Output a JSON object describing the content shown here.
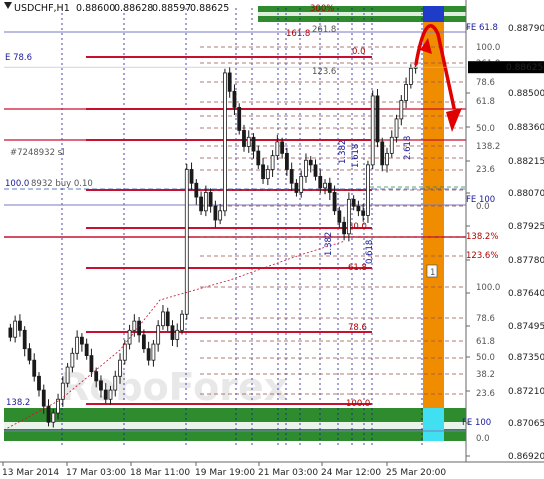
{
  "chart_data": {
    "type": "candlestick",
    "header": {
      "symbol": "USDCHF,H1",
      "ohlc": [
        "0.88600",
        "0.88628",
        "0.88597",
        "0.88625"
      ]
    },
    "last_price": "0.88625",
    "y_ticks": [
      "0.88790",
      "0.88500",
      "0.88360",
      "0.88215",
      "0.88070",
      "0.87925",
      "0.87780",
      "0.87640",
      "0.87495",
      "0.87350",
      "0.87210",
      "0.87065",
      "0.86920"
    ],
    "x_ticks": [
      "13 Mar 2014",
      "17 Mar 03:00",
      "18 Mar 11:00",
      "19 Mar 19:00",
      "21 Mar 03:00",
      "24 Mar 12:00",
      "25 Mar 20:00"
    ],
    "price_range": [
      0.8692,
      0.889
    ],
    "series_close": [
      0.8745,
      0.8752,
      0.8748,
      0.874,
      0.8735,
      0.8728,
      0.8722,
      0.8715,
      0.8708,
      0.8712,
      0.8718,
      0.8725,
      0.8732,
      0.8738,
      0.8745,
      0.8742,
      0.8737,
      0.873,
      0.8726,
      0.8722,
      0.8718,
      0.8722,
      0.8728,
      0.8735,
      0.8742,
      0.8748,
      0.8752,
      0.8746,
      0.874,
      0.8735,
      0.8742,
      0.875,
      0.8756,
      0.875,
      0.8744,
      0.8748,
      0.8755,
      0.8818,
      0.8812,
      0.8806,
      0.88,
      0.8808,
      0.8802,
      0.8796,
      0.88,
      0.886,
      0.8852,
      0.8845,
      0.8835,
      0.8828,
      0.8832,
      0.8826,
      0.882,
      0.8814,
      0.8818,
      0.8824,
      0.883,
      0.8825,
      0.8818,
      0.8812,
      0.8808,
      0.8815,
      0.8822,
      0.882,
      0.8815,
      0.881,
      0.8812,
      0.8808,
      0.88,
      0.8795,
      0.879,
      0.8805,
      0.8802,
      0.88,
      0.8798,
      0.882,
      0.885,
      0.883,
      0.882,
      0.8825,
      0.8832,
      0.884,
      0.8848,
      0.8855,
      0.8862,
      0.88625
    ],
    "retracement_labels_red": [
      "0.0",
      "50.0",
      "61.8",
      "78.6",
      "100.0",
      "138.2%",
      "123.6%",
      "161.8",
      "300%"
    ],
    "retracement_labels_gray": [
      "100.0",
      "261.8",
      "78.6",
      "61.8",
      "50.0",
      "38.2",
      "23.6",
      "0.0",
      "138.2",
      "123.6",
      "100.0",
      "78.6",
      "61.8",
      "50.0",
      "38.2",
      "23.6",
      "0.0"
    ],
    "left_labels": [
      "E 78.6",
      "#7248932 sl",
      "100.0",
      "8932 buy 0.10",
      "138.2"
    ],
    "right_labels": [
      "FE 61.8",
      "FE 100",
      "FE 100"
    ],
    "vertical_labels": [
      "2.618",
      "1.382",
      "1.618",
      "1.382",
      "0.618",
      "2.618"
    ],
    "marker": "1",
    "colors": {
      "bull": "#1a1a1a",
      "support_zone": "#2e8b2e",
      "resistance_zone": "#2e8b2e",
      "forecast_column": "#f08c00",
      "forecast_cap": "#1e3cc8",
      "forecast_base": "#40e0f0",
      "arrow": "#e00000",
      "level_red": "#c8102e",
      "level_gray": "#9a5050",
      "vline": "#1a1a9a"
    },
    "watermark": "RoboForex"
  }
}
